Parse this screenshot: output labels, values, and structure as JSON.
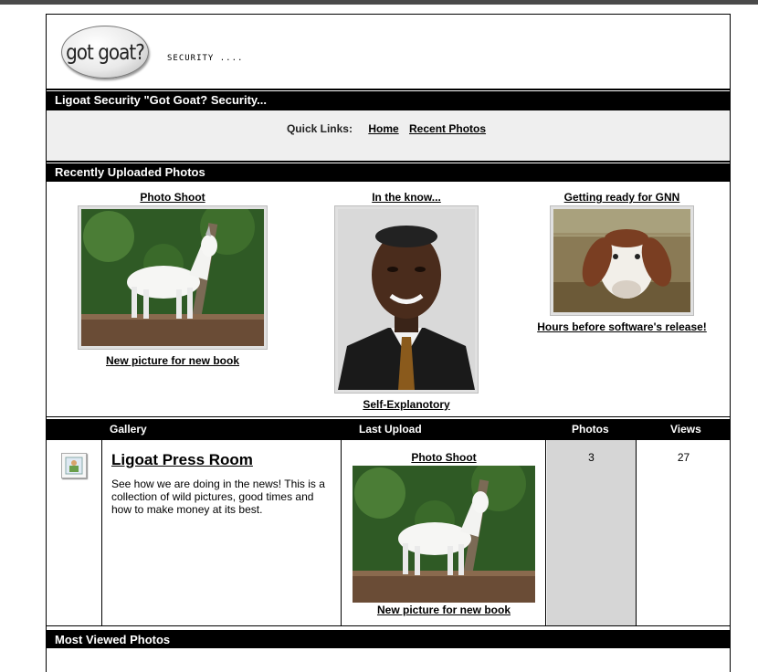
{
  "header": {
    "logo_text": "got goat?",
    "tagline": "SECURITY ...."
  },
  "title_bar": "Ligoat Security \"Got Goat? Security...",
  "quick_links": {
    "label": "Quick Links:",
    "items": [
      "Home",
      "Recent Photos"
    ]
  },
  "recent": {
    "heading": "Recently Uploaded Photos",
    "photos": [
      {
        "title": "Photo Shoot",
        "caption": "New picture for new book",
        "image": "white-goat-photo"
      },
      {
        "title": "In the know...",
        "caption": "Self-Explanotory",
        "image": "man-portrait-photo"
      },
      {
        "title": "Getting ready for GNN",
        "caption": "Hours before software's release!",
        "image": "brown-goat-photo"
      }
    ]
  },
  "gallery_table": {
    "headers": {
      "gallery": "Gallery",
      "last_upload": "Last Upload",
      "photos": "Photos",
      "views": "Views"
    },
    "row": {
      "icon": "gallery-icon",
      "name": "Ligoat Press Room",
      "description": "See how we are doing in the news! This is a collection of wild pictures, good times and how to make money at its best.",
      "last_upload_title": "Photo Shoot",
      "last_upload_caption": "New picture for new book",
      "photos": "3",
      "views": "27"
    }
  },
  "most_viewed": {
    "heading": "Most Viewed Photos"
  },
  "colors": {
    "bar": "#000000",
    "light_panel": "#efefef",
    "count_col": "#d6d6d6"
  }
}
